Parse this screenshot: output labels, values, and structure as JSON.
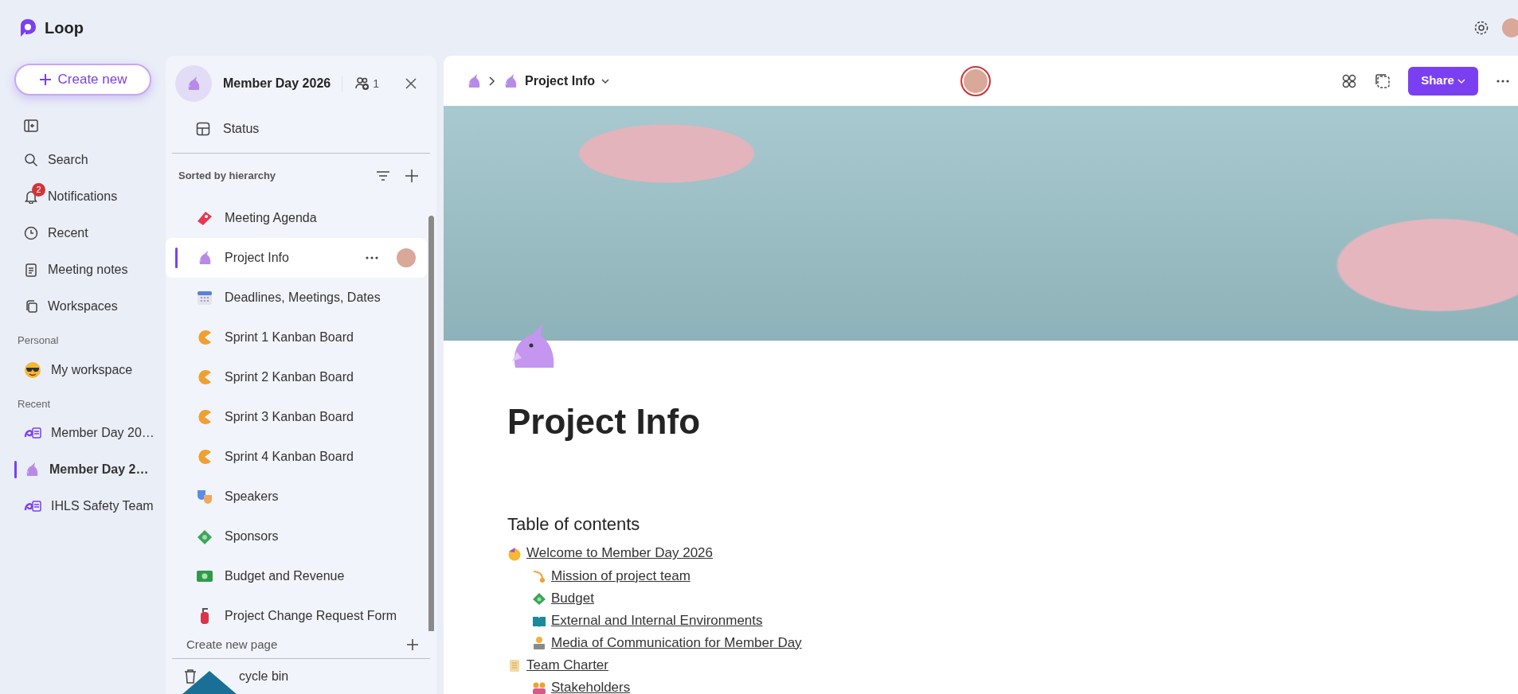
{
  "app": {
    "name": "Loop"
  },
  "nav": {
    "create_button": "Create new",
    "items": [
      {
        "label": "Search"
      },
      {
        "label": "Notifications",
        "badge": "2"
      },
      {
        "label": "Recent"
      },
      {
        "label": "Meeting notes"
      },
      {
        "label": "Workspaces"
      }
    ],
    "personal": {
      "heading": "Personal",
      "items": [
        {
          "label": "My workspace"
        }
      ]
    },
    "recent": {
      "heading": "Recent",
      "items": [
        {
          "label": "Member Day 20…",
          "selected": false
        },
        {
          "label": "Member Day 2…",
          "selected": true
        },
        {
          "label": "IHLS Safety Team",
          "selected": false
        }
      ]
    }
  },
  "workspace": {
    "title": "Member Day 2026",
    "member_count": "1",
    "status_label": "Status",
    "sort_label": "Sorted by hierarchy",
    "pages": [
      {
        "label": "Meeting Agenda",
        "selected": false
      },
      {
        "label": "Project Info",
        "selected": true
      },
      {
        "label": "Deadlines, Meetings, Dates",
        "selected": false
      },
      {
        "label": "Sprint 1 Kanban Board",
        "selected": false
      },
      {
        "label": "Sprint 2 Kanban Board",
        "selected": false
      },
      {
        "label": "Sprint 3 Kanban Board",
        "selected": false
      },
      {
        "label": "Sprint 4 Kanban Board",
        "selected": false
      },
      {
        "label": "Speakers",
        "selected": false
      },
      {
        "label": "Sponsors",
        "selected": false
      },
      {
        "label": "Budget and Revenue",
        "selected": false
      },
      {
        "label": "Project Change Request Form",
        "selected": false
      }
    ],
    "create_page": "Create new page",
    "recycle_bin": "cycle bin"
  },
  "page": {
    "breadcrumb": {
      "current": "Project Info"
    },
    "share_button": "Share",
    "title": "Project Info",
    "toc": {
      "heading": "Table of contents",
      "items": [
        {
          "label": "Welcome to Member Day 2026",
          "children": [
            {
              "label": "Mission of project team"
            },
            {
              "label": "Budget"
            },
            {
              "label": "External and Internal Environments"
            },
            {
              "label": "Media of Communication for Member Day"
            }
          ]
        },
        {
          "label": "Team Charter",
          "children": [
            {
              "label": "Stakeholders"
            }
          ]
        }
      ]
    }
  }
}
